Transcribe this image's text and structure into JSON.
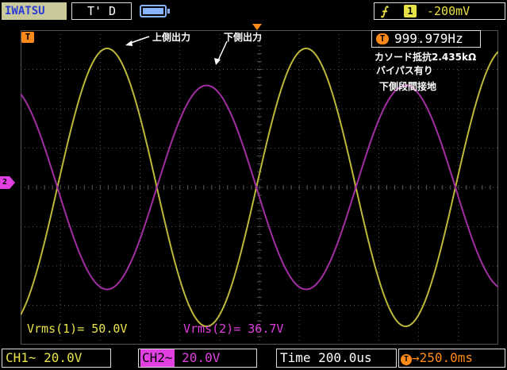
{
  "top": {
    "brand": "IWATSU",
    "mode": "T' D",
    "trigger_edge": "⨍",
    "trigger_channel": "1",
    "trigger_level": "-200mV"
  },
  "markers": {
    "trigger_pos": "T",
    "ch2_marker": "2"
  },
  "readouts": {
    "frequency_icon": "T",
    "frequency": "999.979Hz",
    "vrms1": "Vrms(1)= 50.0V",
    "vrms2": "Vrms(2)= 36.7V"
  },
  "annotations": {
    "upper_output": "上側出力",
    "lower_output": "下側出力",
    "cathode_resistor": "カソード抵抗2.435kΩ",
    "bypass": "バイパス有り",
    "lower_stage_ground": "下側段間接地"
  },
  "bottom": {
    "ch1": "CH1~ 20.0V",
    "ch2_tag": "CH2~",
    "ch2_scale": "20.0V",
    "time": "Time 200.0us",
    "delay_icon": "T",
    "delay": "→250.0ms"
  },
  "colors": {
    "ch1": "#e8e24a",
    "ch1_trace": "#bdb83a",
    "ch2": "#e040e0",
    "ch2_trace": "#a22ea2",
    "grid": "#555555",
    "accent": "#ff8a1a"
  },
  "chart_data": {
    "type": "line",
    "grid": true,
    "series": [
      {
        "name": "CH1",
        "frequency_hz": 999.979,
        "vrms": 50.0,
        "phase_deg": 0
      },
      {
        "name": "CH2",
        "frequency_hz": 999.979,
        "vrms": 36.7,
        "phase_deg": 180
      }
    ]
  }
}
